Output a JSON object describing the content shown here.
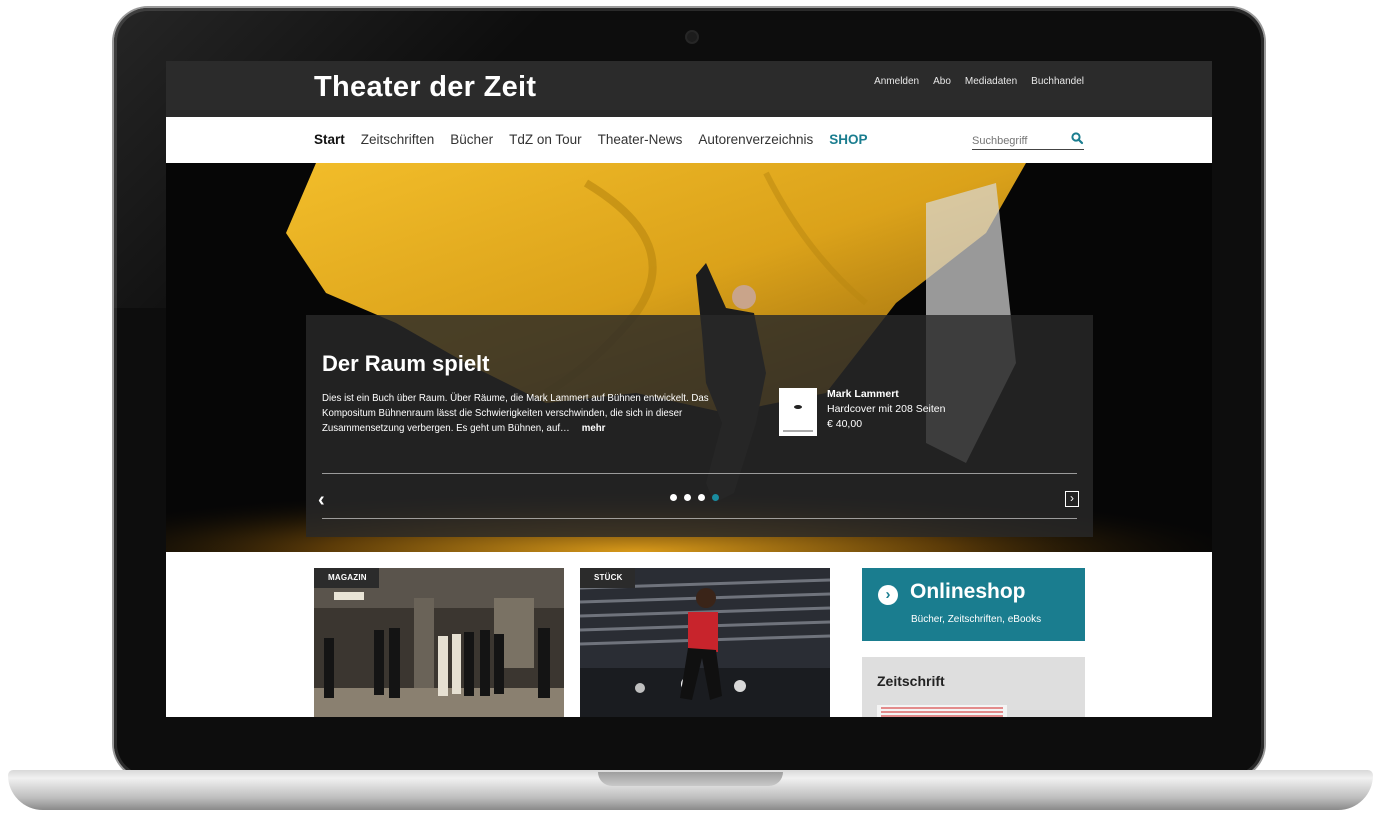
{
  "site": {
    "logo": "Theater der Zeit",
    "util_links": [
      "Anmelden",
      "Abo",
      "Mediadaten",
      "Buchhandel"
    ]
  },
  "nav": {
    "items": [
      "Start",
      "Zeitschriften",
      "Bücher",
      "TdZ on Tour",
      "Theater-News",
      "Autorenverzeichnis",
      "SHOP"
    ],
    "active": "Start"
  },
  "search": {
    "placeholder": "Suchbegriff",
    "icon": "search-icon"
  },
  "hero": {
    "title": "Der Raum spielt",
    "text": "Dies ist ein Buch über Raum. Über Räume, die Mark Lammert auf Bühnen entwickelt. Das Kompositum Bühnenraum lässt die Schwierigkeiten verschwinden, die sich in dieser Zusammensetzung verbergen. Es geht um Bühnen, auf…",
    "more": "mehr",
    "book": {
      "author": "Mark Lammert",
      "format": "Hardcover mit 208 Seiten",
      "price": "€ 40,00"
    },
    "slides_total": 4,
    "current_slide": 4,
    "prev_icon": "‹",
    "next_icon": "›"
  },
  "cards": [
    {
      "tag": "MAGAZIN"
    },
    {
      "tag": "STÜCK"
    }
  ],
  "shop": {
    "title": "Onlineshop",
    "subtitle": "Bücher, Zeitschriften, eBooks",
    "icon": "chevron-right-circle-icon"
  },
  "zeitschrift": {
    "title": "Zeitschrift"
  },
  "colors": {
    "accent": "#1a7d8f",
    "topbar": "#2b2b2b",
    "hero_cloth": "#e0a81c"
  }
}
